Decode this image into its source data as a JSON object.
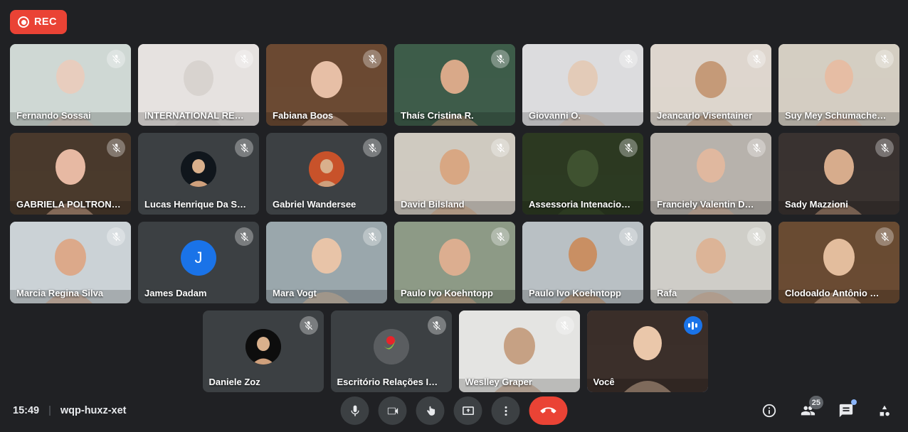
{
  "recording": {
    "label": "REC",
    "icon": "record-icon",
    "color": "#ea4335",
    "active": true
  },
  "meeting": {
    "time": "15:49",
    "code": "wqp-huxz-xet",
    "separator": "|"
  },
  "participants_count": "25",
  "self_label": "Você",
  "rows": [
    [
      {
        "name": "Fernando Sossai",
        "muted": true,
        "type": "video",
        "bg": "#cfd8d4",
        "tone": "#e8cdbe"
      },
      {
        "name": "INTERNATIONAL RE…",
        "muted": true,
        "type": "video",
        "bg": "#e6e2e0",
        "tone": "#d8d3cf"
      },
      {
        "name": "Fabiana Boos",
        "muted": true,
        "type": "video",
        "bg": "#6b4a33",
        "tone": "#e7bfa6"
      },
      {
        "name": "Thaís Cristina R.",
        "muted": true,
        "type": "video",
        "bg": "#3e5c4a",
        "tone": "#d9a989"
      },
      {
        "name": "Giovanni O.",
        "muted": true,
        "type": "video",
        "bg": "#dcdcde",
        "tone": "#e3cbb8"
      },
      {
        "name": "Jeancarlo Visentainer",
        "muted": true,
        "type": "video",
        "bg": "#ddd6cd",
        "tone": "#c59a78"
      },
      {
        "name": "Suy Mey Schumache…",
        "muted": true,
        "type": "video",
        "bg": "#d4cdc2",
        "tone": "#e6bda4"
      }
    ],
    [
      {
        "name": "GABRIELA POLTRON…",
        "muted": true,
        "type": "video",
        "bg": "#4a3a2c",
        "tone": "#e7b9a3"
      },
      {
        "name": "Lucas Henrique Da S…",
        "muted": true,
        "type": "avatar",
        "avatar": "photo",
        "avatar_bg": "#10161c"
      },
      {
        "name": "Gabriel Wandersee",
        "muted": true,
        "type": "avatar",
        "avatar": "photo",
        "avatar_bg": "#c8522a"
      },
      {
        "name": "David Bilsland",
        "muted": true,
        "type": "video",
        "bg": "#cfc9c0",
        "tone": "#d8a783"
      },
      {
        "name": "Assessoria Intenacio…",
        "muted": true,
        "type": "video",
        "bg": "#2c3a22",
        "tone": "#3f5230"
      },
      {
        "name": "Franciely Valentin D…",
        "muted": true,
        "type": "video",
        "bg": "#b7b2ac",
        "tone": "#e0b89f"
      },
      {
        "name": "Sady Mazzioni",
        "muted": true,
        "type": "video",
        "bg": "#3a3330",
        "tone": "#d7ac8c"
      }
    ],
    [
      {
        "name": "Marcia Regina Silva",
        "muted": true,
        "type": "video",
        "bg": "#cbd2d6",
        "tone": "#dca98a"
      },
      {
        "name": "James Dadam",
        "muted": true,
        "type": "initial",
        "initial": "J",
        "avatar_bg": "#1a73e8"
      },
      {
        "name": "Mara Vogt",
        "muted": true,
        "type": "video",
        "bg": "#9aa7ac",
        "tone": "#e8c4a8"
      },
      {
        "name": "Paulo Ivo Koehntopp",
        "muted": true,
        "type": "video",
        "bg": "#8d9a86",
        "tone": "#dcae90"
      },
      {
        "name": "Paulo Ivo Koehntopp",
        "muted": true,
        "type": "video",
        "bg": "#b9c0c4",
        "tone": "#c98f63"
      },
      {
        "name": "Rafa",
        "muted": true,
        "type": "video",
        "bg": "#cfcdc8",
        "tone": "#dcb497"
      },
      {
        "name": "Clodoaldo Antônio …",
        "muted": true,
        "type": "video",
        "bg": "#6a4b33",
        "tone": "#e3bd9d"
      }
    ],
    [
      {
        "name": "Daniele Zoz",
        "muted": true,
        "type": "avatar",
        "avatar": "photo",
        "avatar_bg": "#0d0d0d"
      },
      {
        "name": "Escritório Relações I…",
        "muted": true,
        "type": "logo",
        "avatar_bg": "#5a5d60"
      },
      {
        "name": "Weslley Graper",
        "muted": true,
        "type": "video",
        "bg": "#e4e4e2",
        "tone": "#c6a184"
      },
      {
        "name": "Você",
        "muted": false,
        "speaking": true,
        "self": true,
        "type": "video",
        "bg": "#3b2f2a",
        "tone": "#eac7aa"
      }
    ]
  ],
  "controls": [
    {
      "name": "microphone-button",
      "icon": "mic-icon",
      "label": "Microfone"
    },
    {
      "name": "camera-button",
      "icon": "camera-icon",
      "label": "Câmera"
    },
    {
      "name": "raise-hand-button",
      "icon": "hand-icon",
      "label": "Levantar a mão"
    },
    {
      "name": "present-screen-button",
      "icon": "present-icon",
      "label": "Apresentar agora"
    },
    {
      "name": "more-options-button",
      "icon": "more-vert-icon",
      "label": "Mais opções"
    },
    {
      "name": "end-call-button",
      "icon": "call-end-icon",
      "label": "Sair da chamada"
    }
  ],
  "right_icons": [
    {
      "name": "meeting-details-button",
      "icon": "info-icon",
      "label": "Detalhes da reunião"
    },
    {
      "name": "participants-button",
      "icon": "people-icon",
      "label": "Mostrar todos",
      "badge": "25"
    },
    {
      "name": "chat-button",
      "icon": "chat-icon",
      "label": "Bate-papo com todos",
      "new": true
    },
    {
      "name": "activities-button",
      "icon": "activities-icon",
      "label": "Atividades"
    }
  ]
}
